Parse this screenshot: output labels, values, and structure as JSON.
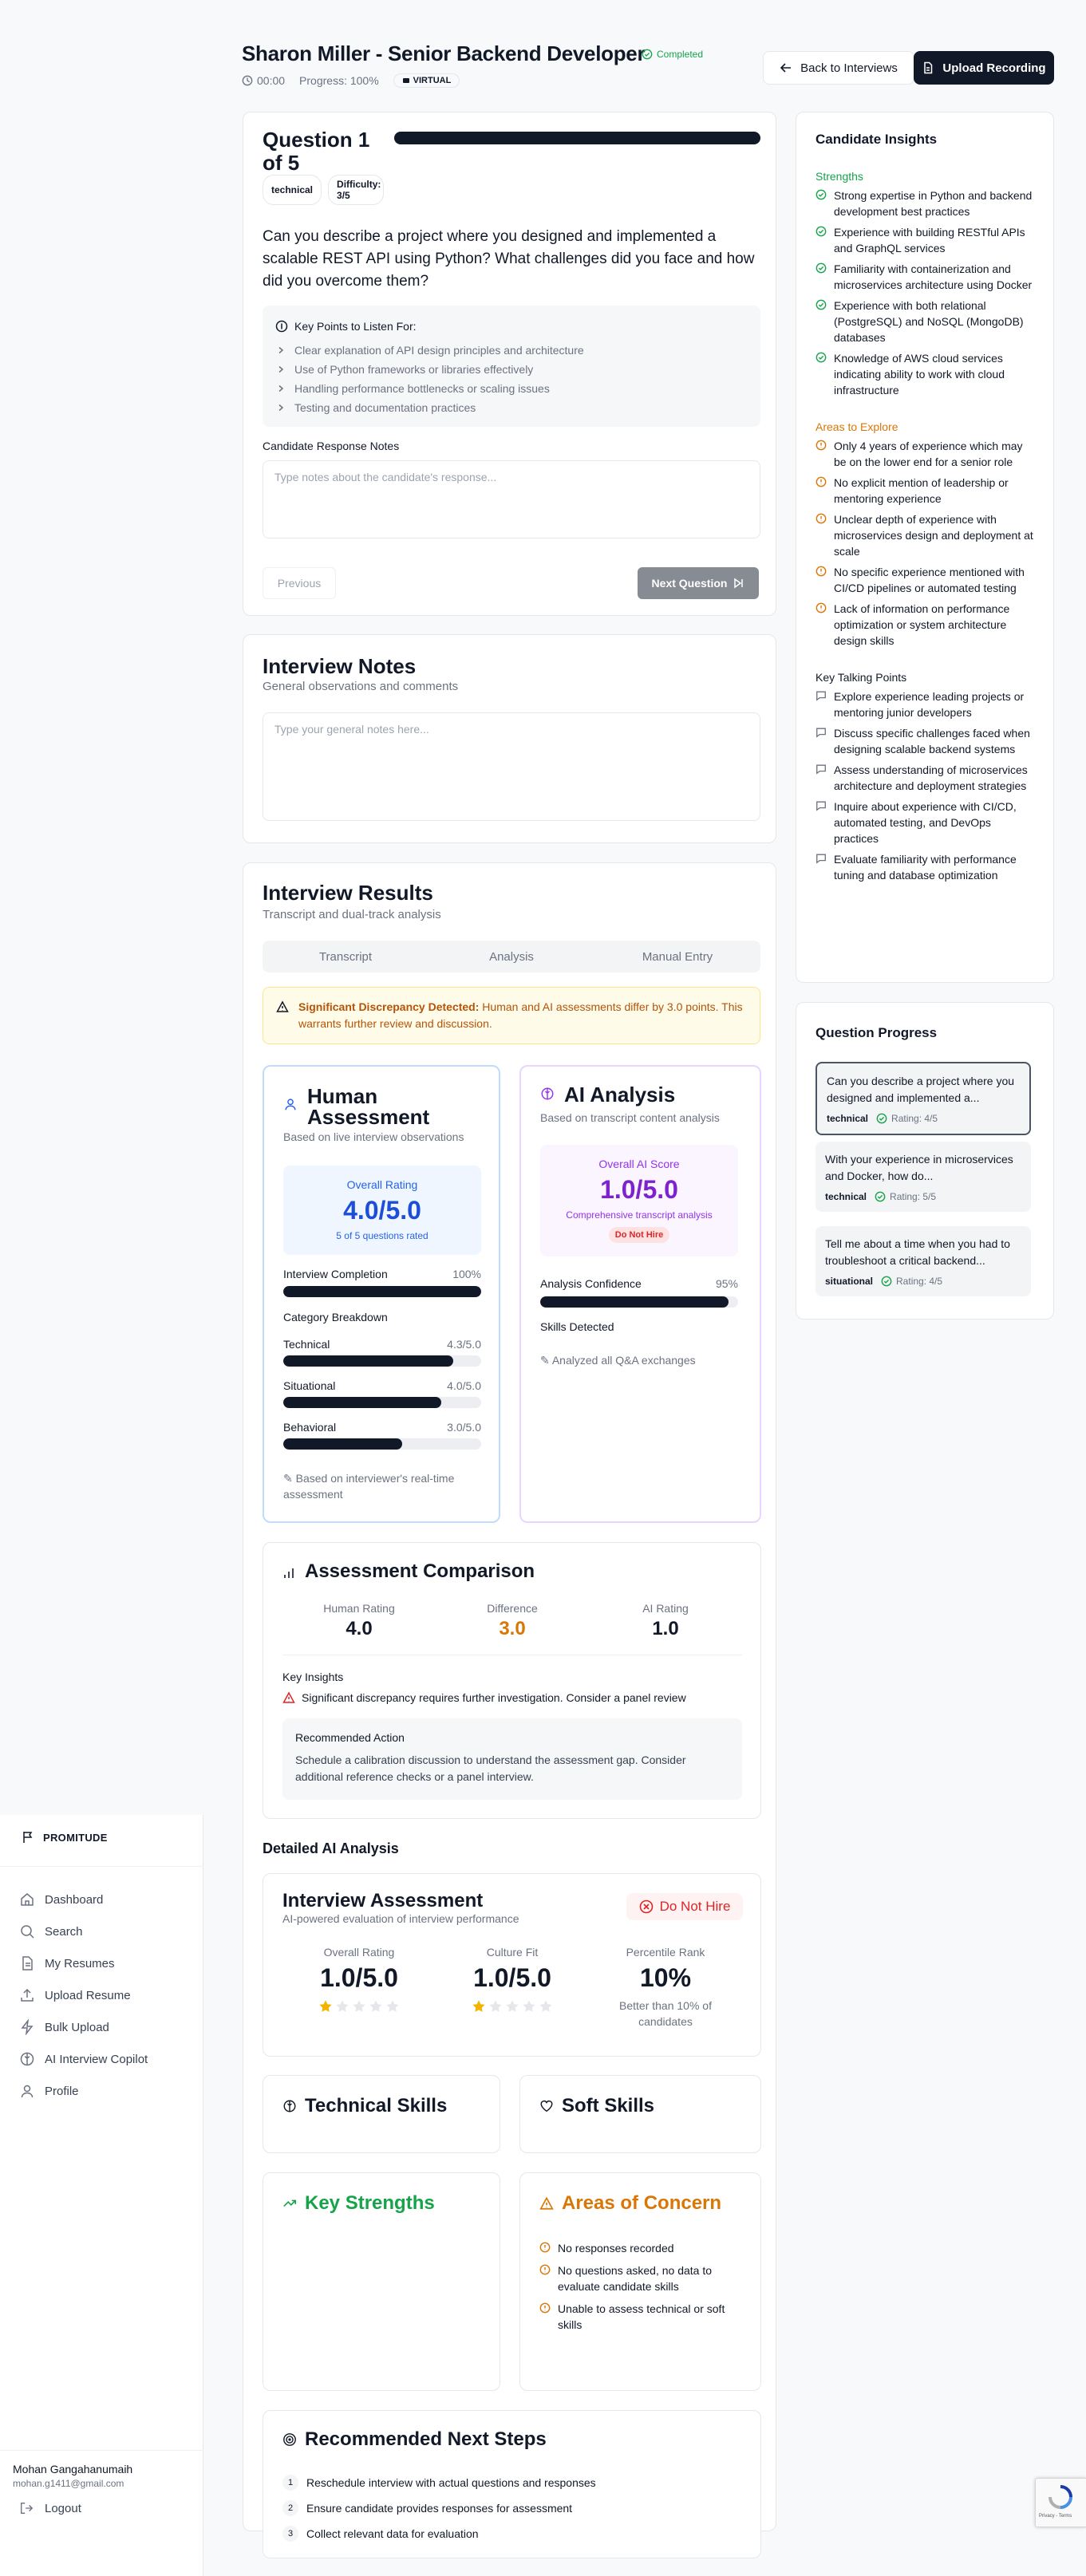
{
  "sidebar": {
    "brand": "PROMITUDE",
    "items": [
      {
        "label": "Dashboard",
        "icon": "home-icon"
      },
      {
        "label": "Search",
        "icon": "search-icon"
      },
      {
        "label": "My Resumes",
        "icon": "document-icon"
      },
      {
        "label": "Upload Resume",
        "icon": "upload-icon"
      },
      {
        "label": "Bulk Upload",
        "icon": "lightning-icon"
      },
      {
        "label": "AI Interview Copilot",
        "icon": "brain-icon"
      },
      {
        "label": "Profile",
        "icon": "user-icon"
      }
    ],
    "user_name": "Mohan Gangahanumaih",
    "user_email": "mohan.g1411@gmail.com",
    "logout_label": "Logout"
  },
  "header": {
    "title": "Sharon Miller - Senior Backend Developer",
    "status": "Completed",
    "timer": "00:00",
    "progress": "Progress: 100%",
    "mode": "VIRTUAL",
    "back_label": "Back to Interviews",
    "upload_label": "Upload Recording"
  },
  "question": {
    "title": "Question 1 of 5",
    "progress_fraction": 1.0,
    "tags": [
      "technical",
      "Difficulty: 3/5"
    ],
    "text": "Can you describe a project where you designed and implemented a scalable REST API using Python? What challenges did you face and how did you overcome them?",
    "key_points_title": "Key Points to Listen For:",
    "key_points": [
      "Clear explanation of API design principles and architecture",
      "Use of Python frameworks or libraries effectively",
      "Handling performance bottlenecks or scaling issues",
      "Testing and documentation practices"
    ],
    "notes_label": "Candidate Response Notes",
    "notes_placeholder": "Type notes about the candidate's response...",
    "prev_label": "Previous",
    "next_label": "Next Question"
  },
  "interview_notes": {
    "title": "Interview Notes",
    "subtitle": "General observations and comments",
    "placeholder": "Type your general notes here..."
  },
  "results": {
    "title": "Interview Results",
    "subtitle": "Transcript and dual-track analysis",
    "tabs": [
      "Transcript",
      "Analysis",
      "Manual Entry"
    ],
    "alert_bold": "Significant Discrepancy Detected:",
    "alert_text": "Human and AI assessments differ by 3.0 points. This warrants further review and discussion.",
    "human": {
      "title": "Human Assessment",
      "subtitle": "Based on live interview observations",
      "overall_label": "Overall Rating",
      "overall_value": "4.0/5.0",
      "overall_note": "5 of 5 questions rated",
      "completion_label": "Interview Completion",
      "completion_value": "100%",
      "completion_fraction": 1.0,
      "category_title": "Category Breakdown",
      "categories": [
        {
          "name": "Technical",
          "value": "4.3/5.0",
          "fraction": 0.86
        },
        {
          "name": "Situational",
          "value": "4.0/5.0",
          "fraction": 0.8
        },
        {
          "name": "Behavioral",
          "value": "3.0/5.0",
          "fraction": 0.6
        }
      ],
      "footnote": "✎ Based on interviewer's real-time assessment"
    },
    "ai": {
      "title": "AI Analysis",
      "subtitle": "Based on transcript content analysis",
      "score_label": "Overall AI Score",
      "score_value": "1.0/5.0",
      "score_note": "Comprehensive transcript analysis",
      "verdict": "Do Not Hire",
      "confidence_label": "Analysis Confidence",
      "confidence_value": "95%",
      "confidence_fraction": 0.95,
      "skills_label": "Skills Detected",
      "footnote": "✎ Analyzed all Q&A exchanges"
    },
    "comparison": {
      "title": "Assessment Comparison",
      "human_label": "Human Rating",
      "human_value": "4.0",
      "diff_label": "Difference",
      "diff_value": "3.0",
      "ai_label": "AI Rating",
      "ai_value": "1.0",
      "insights_title": "Key Insights",
      "insight": "Significant discrepancy requires further investigation. Consider a panel review",
      "action_title": "Recommended Action",
      "action_text": "Schedule a calibration discussion to understand the assessment gap. Consider additional reference checks or a panel interview."
    }
  },
  "detailed": {
    "title": "Detailed AI Analysis",
    "assessment_title": "Interview Assessment",
    "assessment_subtitle": "AI-powered evaluation of interview performance",
    "verdict": "Do Not Hire",
    "overall_label": "Overall Rating",
    "overall_value": "1.0/5.0",
    "overall_stars": 1,
    "culture_label": "Culture Fit",
    "culture_value": "1.0/5.0",
    "culture_stars": 1,
    "percentile_label": "Percentile Rank",
    "percentile_value": "10%",
    "percentile_note": "Better than 10% of candidates",
    "technical_skills": "Technical Skills",
    "soft_skills": "Soft Skills",
    "strengths_title": "Key Strengths",
    "concerns_title": "Areas of Concern",
    "concerns": [
      "No responses recorded",
      "No questions asked, no data to evaluate candidate skills",
      "Unable to assess technical or soft skills"
    ],
    "next_steps_title": "Recommended Next Steps",
    "next_steps": [
      "Reschedule interview with actual questions and responses",
      "Ensure candidate provides responses for assessment",
      "Collect relevant data for evaluation"
    ]
  },
  "insights": {
    "title": "Candidate Insights",
    "strengths_title": "Strengths",
    "strengths": [
      "Strong expertise in Python and backend development best practices",
      "Experience with building RESTful APIs and GraphQL services",
      "Familiarity with containerization and microservices architecture using Docker",
      "Experience with both relational (PostgreSQL) and NoSQL (MongoDB) databases",
      "Knowledge of AWS cloud services indicating ability to work with cloud infrastructure"
    ],
    "explore_title": "Areas to Explore",
    "explore": [
      "Only 4 years of experience which may be on the lower end for a senior role",
      "No explicit mention of leadership or mentoring experience",
      "Unclear depth of experience with microservices design and deployment at scale",
      "No specific experience mentioned with CI/CD pipelines or automated testing",
      "Lack of information on performance optimization or system architecture design skills"
    ],
    "talking_title": "Key Talking Points",
    "talking": [
      "Explore experience leading projects or mentoring junior developers",
      "Discuss specific challenges faced when designing scalable backend systems",
      "Assess understanding of microservices architecture and deployment strategies",
      "Inquire about experience with CI/CD, automated testing, and DevOps practices",
      "Evaluate familiarity with performance tuning and database optimization"
    ]
  },
  "question_progress": {
    "title": "Question Progress",
    "items": [
      {
        "text": "Can you describe a project where you designed and implemented a...",
        "type": "technical",
        "rating": "Rating: 4/5"
      },
      {
        "text": "With your experience in microservices and Docker, how do...",
        "type": "technical",
        "rating": "Rating: 5/5"
      },
      {
        "text": "Tell me about a time when you had to troubleshoot a critical backend...",
        "type": "situational",
        "rating": "Rating: 4/5"
      }
    ]
  },
  "recaptcha": {
    "label": "Privacy - Terms"
  },
  "colors": {
    "primary": "#111827",
    "green": "#16a34a",
    "orange": "#d97706",
    "blue": "#2563eb",
    "purple": "#9333ea",
    "red": "#dc2626"
  }
}
